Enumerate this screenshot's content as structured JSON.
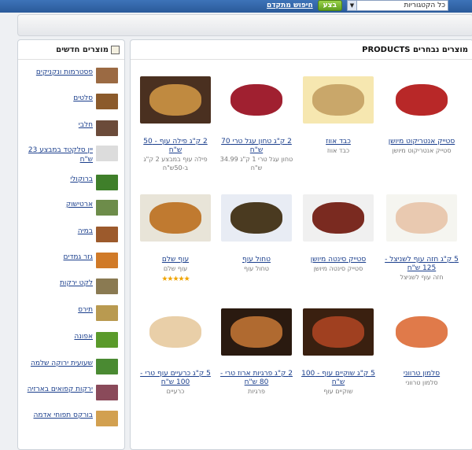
{
  "header": {
    "category_select": "כל הקטגוריות",
    "go_button": "בצע",
    "advanced_search": "חיפוש מתקדם"
  },
  "sidebar": {
    "title": "מוצרים חדשים",
    "items": [
      {
        "label": "פסטרמות ונקניקים",
        "thumb": "#9b6a43"
      },
      {
        "label": "סלטים",
        "thumb": "#8b5a2b"
      },
      {
        "label": "חלבי",
        "thumb": "#6b4b3a"
      },
      {
        "label": "יין סלקטד במבצע 23 ש\"ח",
        "thumb": "#dcdcdc"
      },
      {
        "label": "ברוקולי",
        "thumb": "#3f7f2a"
      },
      {
        "label": "ארטישוק",
        "thumb": "#6d8c4a"
      },
      {
        "label": "במיה",
        "thumb": "#9c5a2c"
      },
      {
        "label": "גזר גמדים",
        "thumb": "#d07a28"
      },
      {
        "label": "לקט ירקות",
        "thumb": "#8a7a52"
      },
      {
        "label": "תירס",
        "thumb": "#b99a50"
      },
      {
        "label": "אפונה",
        "thumb": "#5a9a2a"
      },
      {
        "label": "שעועית ירוקה שלמה",
        "thumb": "#4a8a32"
      },
      {
        "label": "ירקות קפואים בארזיה",
        "thumb": "#8a4a5a"
      },
      {
        "label": "בורקס תפוחי אדמה",
        "thumb": "#d2a050"
      }
    ]
  },
  "main": {
    "title": "מוצרים נבחרים PRODUCTS",
    "products": [
      {
        "title": "סטייק אנטריקוט מיושן",
        "sub": "סטייק אנטריקוט מיושן",
        "color": "#b82828",
        "bg": "#ffffff"
      },
      {
        "title": "כבד אווז",
        "sub": "כבד אווז",
        "color": "#c9a76a",
        "bg": "#f6e7b0"
      },
      {
        "title": "2 ק\"ג טחון עגל טרי 70 ש\"ח",
        "sub": "טחון עגל טרי 1 ק\"ג 34.99 ש\"ח",
        "color": "#a02030",
        "bg": "#ffffff"
      },
      {
        "title": "2 ק\"ג פילה עוף - 50 ש\"ח",
        "sub": "פילה עוף במבצע 2 ק\"ג ב-50ש\"ח",
        "color": "#c08a40",
        "bg": "#4a3020"
      },
      {
        "title": "5 ק\"ג חזה עוף לשניצל - 125 ש\"ח",
        "sub": "חזה עוף לשניצל",
        "color": "#e9c9b0",
        "bg": "#f5f5f0"
      },
      {
        "title": "סטייק סינטה מיושן",
        "sub": "סטייק סינטה מיושן",
        "color": "#7a2a20",
        "bg": "#f0f0f0"
      },
      {
        "title": "טחול עוף",
        "sub": "טחול עוף",
        "color": "#4a3a20",
        "bg": "#e8ecf4"
      },
      {
        "title": "עוף שלם",
        "sub": "עוף שלם",
        "color": "#c07a30",
        "bg": "#e8e4d8",
        "rating": "★★★★★"
      },
      {
        "title": "סלמון טרווני",
        "sub": "סלמון טרווני",
        "color": "#e07a4a",
        "bg": "#ffffff"
      },
      {
        "title": "5 ק\"ג שוקיים עוף - 100 ש\"ח",
        "sub": "שוקיים עוף",
        "color": "#a04020",
        "bg": "#3a2010"
      },
      {
        "title": "2 ק\"ג פרגיות ארוז טרי - 80 ש\"ח",
        "sub": "פרגיות",
        "color": "#b06a30",
        "bg": "#2a1a10"
      },
      {
        "title": "5 ק\"ג כרעיים עוף טרי - 100 ש\"ח",
        "sub": "כרעיים",
        "color": "#e9cfa8",
        "bg": "#ffffff"
      }
    ]
  }
}
